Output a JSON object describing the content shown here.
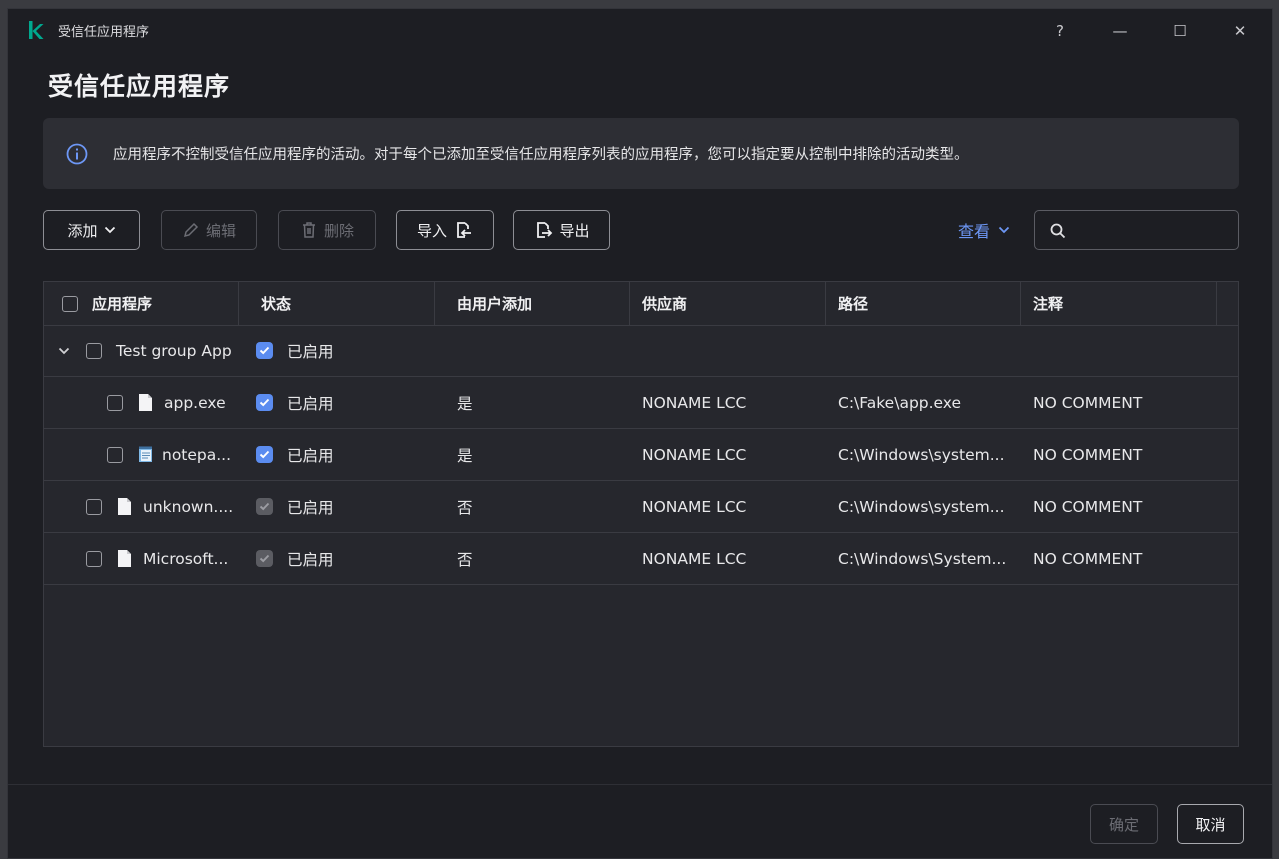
{
  "window": {
    "title": "受信任应用程序",
    "controls": {
      "help": "?",
      "minimize": "—",
      "maximize": "☐",
      "close": "✕"
    }
  },
  "page_title": "受信任应用程序",
  "info_banner": {
    "text": "应用程序不控制受信任应用程序的活动。对于每个已添加至受信任应用程序列表的应用程序，您可以指定要从控制中排除的活动类型。"
  },
  "toolbar": {
    "add": "添加",
    "edit": "编辑",
    "delete": "删除",
    "import": "导入",
    "export": "导出",
    "view": "查看",
    "search_placeholder": ""
  },
  "table": {
    "columns": [
      "应用程序",
      "状态",
      "由用户添加",
      "供应商",
      "路径",
      "注释"
    ],
    "group": {
      "name": "Test group App",
      "status": "已启用"
    },
    "rows": [
      {
        "name": "app.exe",
        "status": "已启用",
        "user_added": "是",
        "vendor": "NONAME LCC",
        "path": "C:\\Fake\\app.exe",
        "comment": "NO COMMENT"
      },
      {
        "name": "notepa...",
        "status": "已启用",
        "user_added": "是",
        "vendor": "NONAME LCC",
        "path": "C:\\Windows\\system...",
        "comment": "NO COMMENT"
      },
      {
        "name": "unknown....",
        "status": "已启用",
        "user_added": "否",
        "vendor": "NONAME LCC",
        "path": "C:\\Windows\\system...",
        "comment": "NO COMMENT"
      },
      {
        "name": "Microsoft...",
        "status": "已启用",
        "user_added": "否",
        "vendor": "NONAME LCC",
        "path": "C:\\Windows\\System...",
        "comment": "NO COMMENT"
      }
    ]
  },
  "footer": {
    "ok": "确定",
    "cancel": "取消"
  },
  "colors": {
    "accent": "#5b8cf0",
    "link": "#6d97f5",
    "logo": "#00a88e",
    "background": "#1d1e23"
  },
  "icons": [
    "kaspersky-logo",
    "info-icon",
    "chevron-down-icon",
    "pencil-icon",
    "trash-icon",
    "import-icon",
    "export-icon",
    "search-icon",
    "file-icon",
    "notepad-icon",
    "checkbox-checked-icon"
  ]
}
